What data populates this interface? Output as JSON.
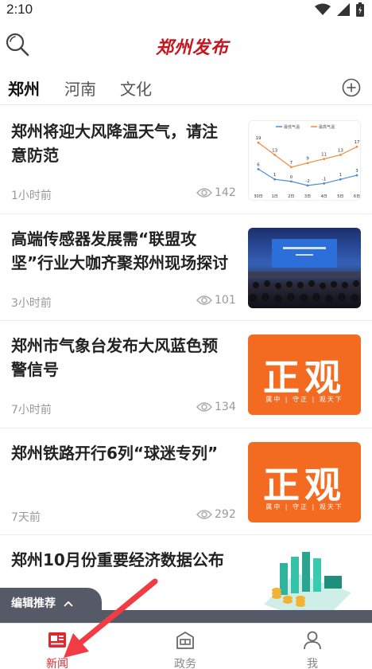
{
  "status_bar": {
    "time": "2:10"
  },
  "header": {
    "logo_text": "郑州发布"
  },
  "tabs": [
    {
      "label": "郑州",
      "active": true
    },
    {
      "label": "河南",
      "active": false
    },
    {
      "label": "文化",
      "active": false
    }
  ],
  "chart_thumb": {
    "legend": [
      "最低气温",
      "最高气温"
    ],
    "high": [
      19,
      13,
      7,
      9,
      11,
      13,
      17
    ],
    "low": [
      6,
      1,
      0,
      -2,
      -1,
      1,
      3
    ],
    "x_labels": [
      "30日",
      "1日",
      "2日",
      "3日",
      "4日",
      "5日",
      "6日"
    ]
  },
  "news": [
    {
      "title": "郑州将迎大风降温天气，请注意防范",
      "time": "1小时前",
      "views": "142",
      "thumb": "chart"
    },
    {
      "title": "高端传感器发展需“联盟攻坚”行业大咖齐聚郑州现场探讨",
      "time": "3小时前",
      "views": "101",
      "thumb": "conference"
    },
    {
      "title": "郑州市气象台发布大风蓝色预警信号",
      "time": "7小时前",
      "views": "134",
      "thumb": "orange",
      "logo_big": "正观",
      "logo_small": "属中 | 守正 | 观天下"
    },
    {
      "title": "郑州铁路开行6列“球迷专列”",
      "time": "7天前",
      "views": "292",
      "thumb": "orange",
      "logo_big": "正观",
      "logo_small": "属中 | 守正 | 观天下"
    },
    {
      "title": "郑州10月份重要经济数据公布",
      "time": "",
      "views": "",
      "thumb": "illustration"
    }
  ],
  "editor_pick": {
    "label": "编辑推荐"
  },
  "bottom_nav": [
    {
      "label": "新闻",
      "icon": "newspaper-icon",
      "active": true
    },
    {
      "label": "政务",
      "icon": "government-icon",
      "active": false
    },
    {
      "label": "我",
      "icon": "person-icon",
      "active": false
    }
  ],
  "colors": {
    "accent": "#e0262e",
    "orange": "#f36b20",
    "logo_red": "#c8141e"
  }
}
